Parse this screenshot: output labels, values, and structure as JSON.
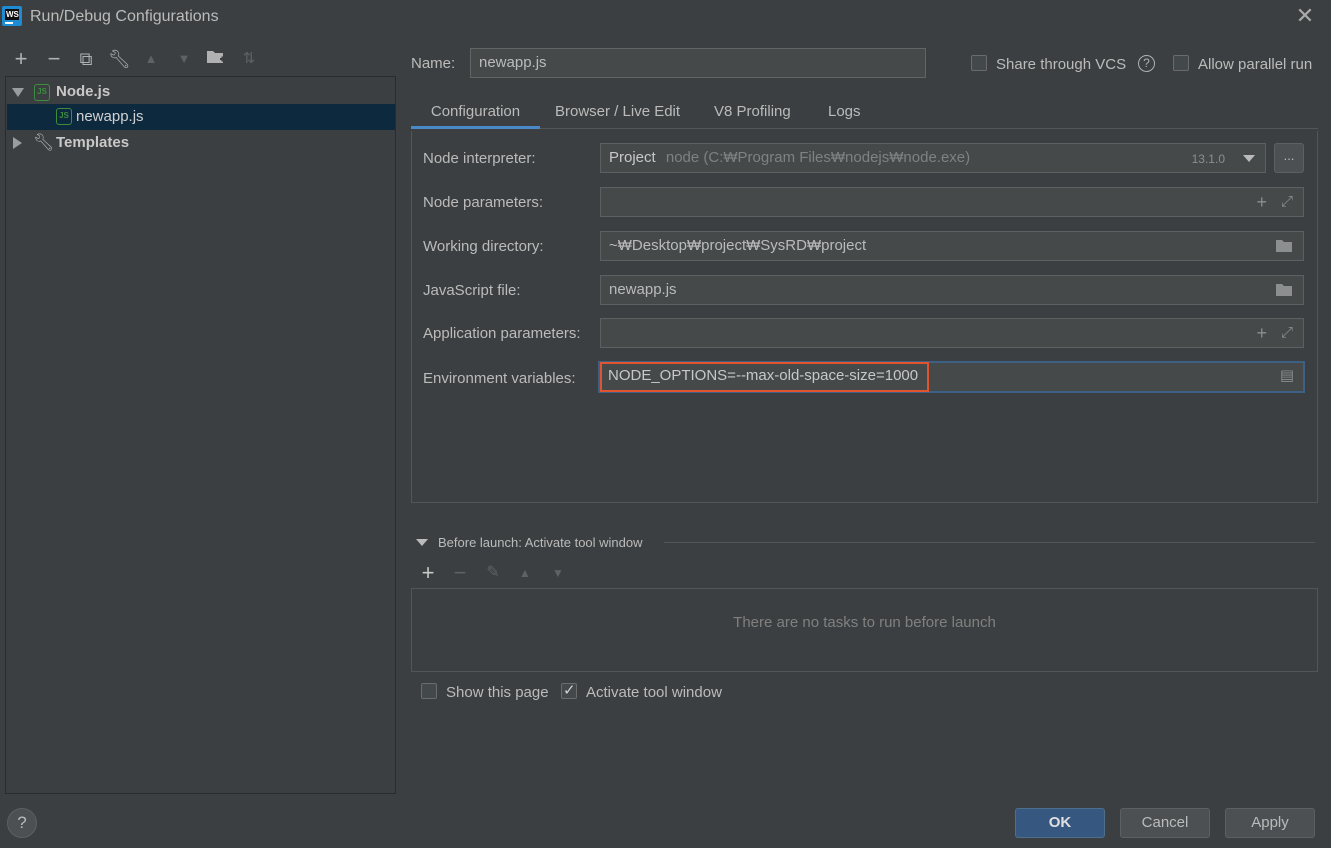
{
  "window": {
    "title": "Run/Debug Configurations",
    "app_icon": "webstorm-icon",
    "app_icon_text": "WS"
  },
  "left_toolbar": {
    "icons": [
      "add-icon",
      "remove-icon",
      "copy-icon",
      "wrench-icon",
      "arrow-up-icon",
      "arrow-down-icon",
      "new-folder-icon",
      "sort-icon"
    ]
  },
  "tree": {
    "items": [
      {
        "label": "Node.js",
        "expanded": true,
        "icon_text": "JS"
      },
      {
        "label": "newapp.js",
        "selected": true,
        "icon_text": "JS"
      },
      {
        "label": "Templates",
        "expanded": false
      }
    ]
  },
  "name_field": {
    "label": "Name:",
    "value": "newapp.js"
  },
  "options": {
    "share_vcs": {
      "label": "Share through VCS",
      "checked": false,
      "help": "?"
    },
    "allow_parallel": {
      "label": "Allow parallel run",
      "checked": false
    }
  },
  "tabs": [
    {
      "label": "Configuration",
      "active": true
    },
    {
      "label": "Browser / Live Edit",
      "active": false
    },
    {
      "label": "V8 Profiling",
      "active": false
    },
    {
      "label": "Logs",
      "active": false
    }
  ],
  "config": {
    "node_interpreter": {
      "label": "Node interpreter:",
      "prefix": "Project",
      "value": "node (C:₩Program Files₩nodejs₩node.exe)",
      "version": "13.1.0",
      "browse_label": "..."
    },
    "node_parameters": {
      "label": "Node parameters:",
      "value": ""
    },
    "working_directory": {
      "label": "Working directory:",
      "value": "~₩Desktop₩project₩SysRD₩project"
    },
    "javascript_file": {
      "label": "JavaScript file:",
      "value": "newapp.js"
    },
    "application_parameters": {
      "label": "Application parameters:",
      "value": ""
    },
    "environment_variables": {
      "label": "Environment variables:",
      "value": "NODE_OPTIONS=--max-old-space-size=1000"
    }
  },
  "before_launch": {
    "title": "Before launch: Activate tool window",
    "empty_text": "There are no tasks to run before launch",
    "toolbar_icons": [
      "add-icon",
      "remove-icon",
      "edit-icon",
      "move-up-icon",
      "move-down-icon"
    ]
  },
  "footer_options": {
    "show_page": {
      "label": "Show this page",
      "checked": false
    },
    "activate_tool": {
      "label": "Activate tool window",
      "checked": true
    }
  },
  "buttons": {
    "ok": "OK",
    "cancel": "Cancel",
    "apply": "Apply",
    "help": "?"
  },
  "colors": {
    "background": "#3c3f41",
    "selection": "#0d293e",
    "accent_tab": "#4a88c7",
    "ok_button": "#365880",
    "highlight_outline": "#e0542f"
  }
}
